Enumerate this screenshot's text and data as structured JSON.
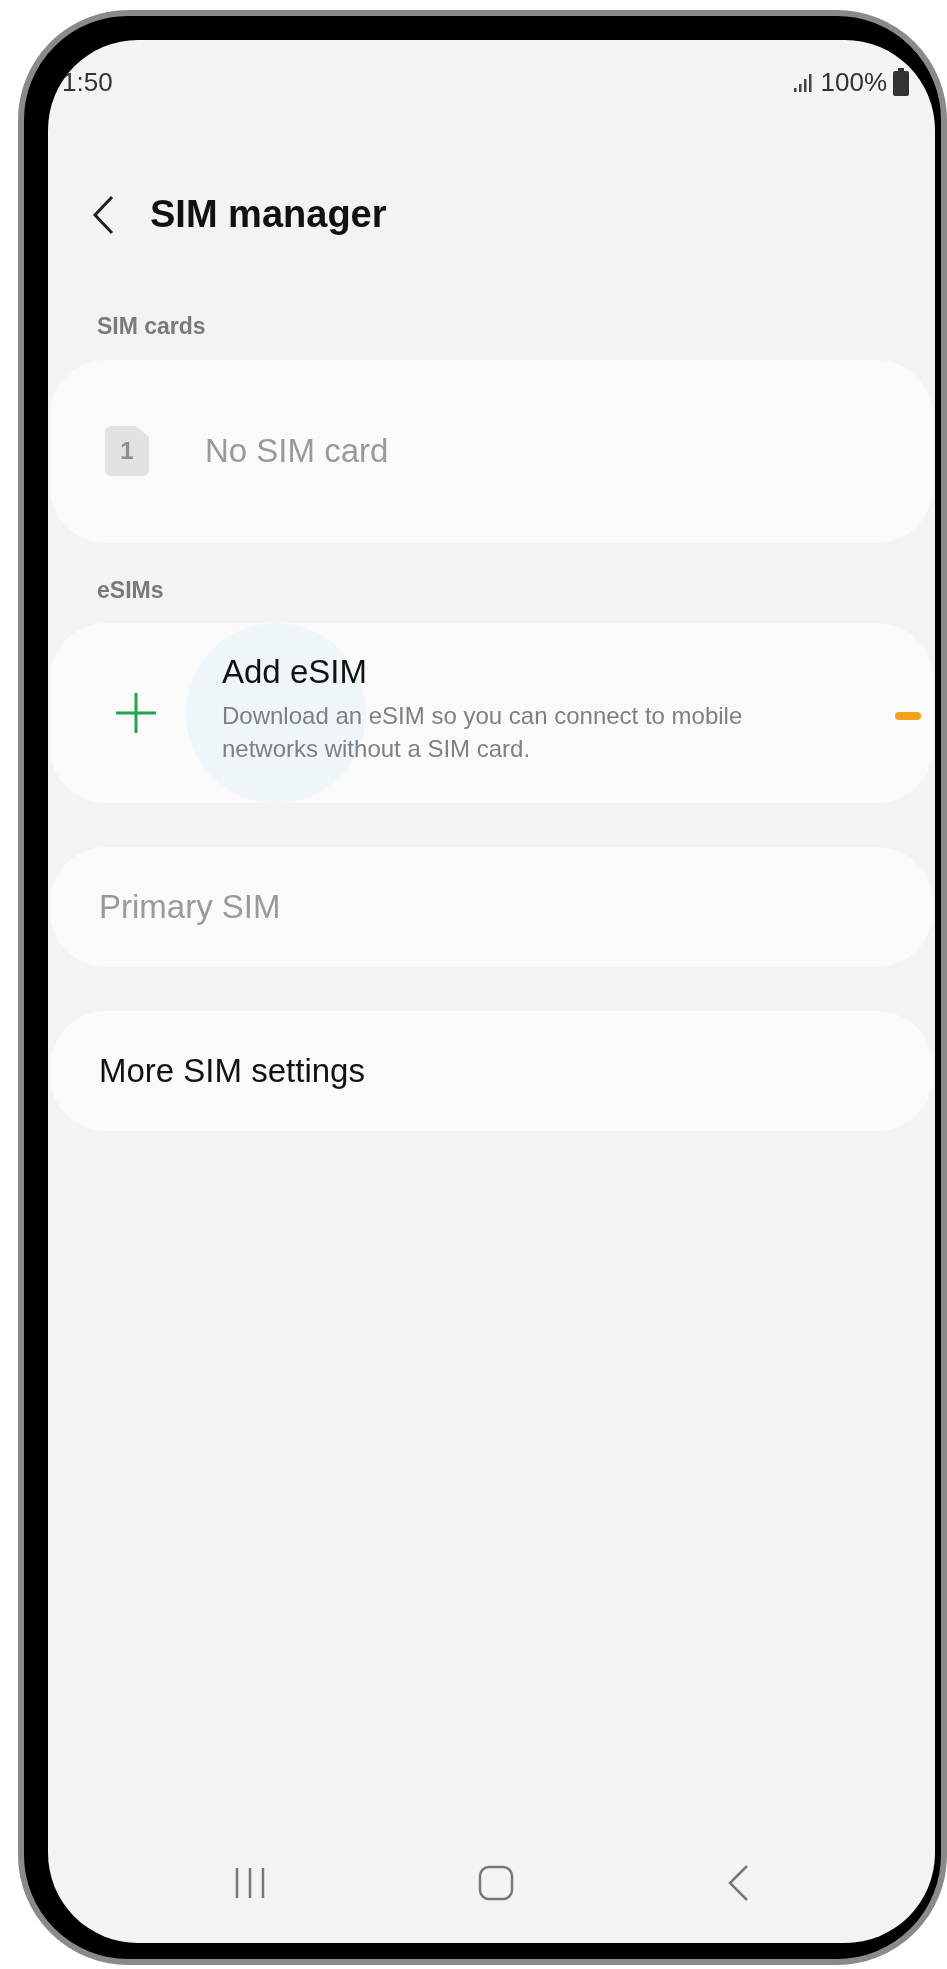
{
  "status_bar": {
    "time": "1:50",
    "battery": "100%"
  },
  "header": {
    "title": "SIM manager"
  },
  "sections": [
    {
      "label": "SIM cards",
      "items": [
        {
          "kind": "sim",
          "badge": "1",
          "title": "No SIM card",
          "disabled": true
        }
      ]
    },
    {
      "label": "eSIMs",
      "items": [
        {
          "kind": "add",
          "title": "Add eSIM",
          "description": "Download an eSIM so you can connect to mobile networks without a SIM card.",
          "disabled": false
        }
      ]
    }
  ],
  "settings": [
    {
      "title": "Primary SIM",
      "disabled": true
    },
    {
      "title": "More SIM settings",
      "disabled": false
    }
  ]
}
